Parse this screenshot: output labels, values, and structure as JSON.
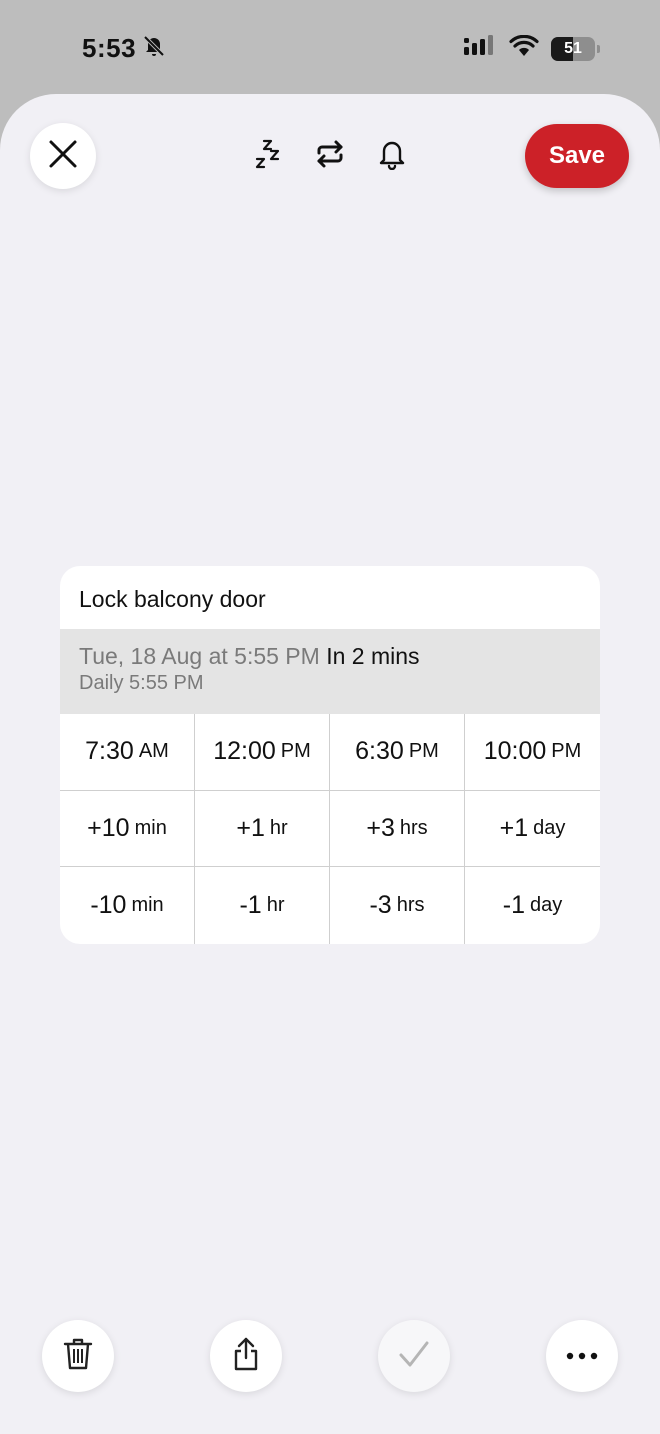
{
  "status_bar": {
    "time": "5:53",
    "battery": "51"
  },
  "icons": {
    "mute": "bell-slash-icon",
    "signal": "cellular-signal-icon",
    "wifi": "wifi-icon",
    "close": "close-icon",
    "snooze": "snooze-zzz-icon",
    "repeat": "repeat-icon",
    "alert": "bell-icon",
    "delete": "trash-icon",
    "share": "share-icon",
    "done": "checkmark-icon",
    "more": "ellipsis-icon"
  },
  "header": {
    "save_label": "Save"
  },
  "reminder": {
    "title": "Lock balcony door",
    "date": "Tue, 18 Aug at 5:55 PM",
    "relative": "In 2 mins",
    "repeat": "Daily 5:55 PM"
  },
  "quick_times": [
    {
      "value": "7:30",
      "unit": "AM"
    },
    {
      "value": "12:00",
      "unit": "PM"
    },
    {
      "value": "6:30",
      "unit": "PM"
    },
    {
      "value": "10:00",
      "unit": "PM"
    }
  ],
  "increments": [
    {
      "value": "+10",
      "unit": "min"
    },
    {
      "value": "+1",
      "unit": "hr"
    },
    {
      "value": "+3",
      "unit": "hrs"
    },
    {
      "value": "+1",
      "unit": "day"
    }
  ],
  "decrements": [
    {
      "value": "-10",
      "unit": "min"
    },
    {
      "value": "-1",
      "unit": "hr"
    },
    {
      "value": "-3",
      "unit": "hrs"
    },
    {
      "value": "-1",
      "unit": "day"
    }
  ],
  "colors": {
    "accent": "#cc2128",
    "sheet_background": "#f1f0f5",
    "date_band": "#e4e4e4"
  }
}
